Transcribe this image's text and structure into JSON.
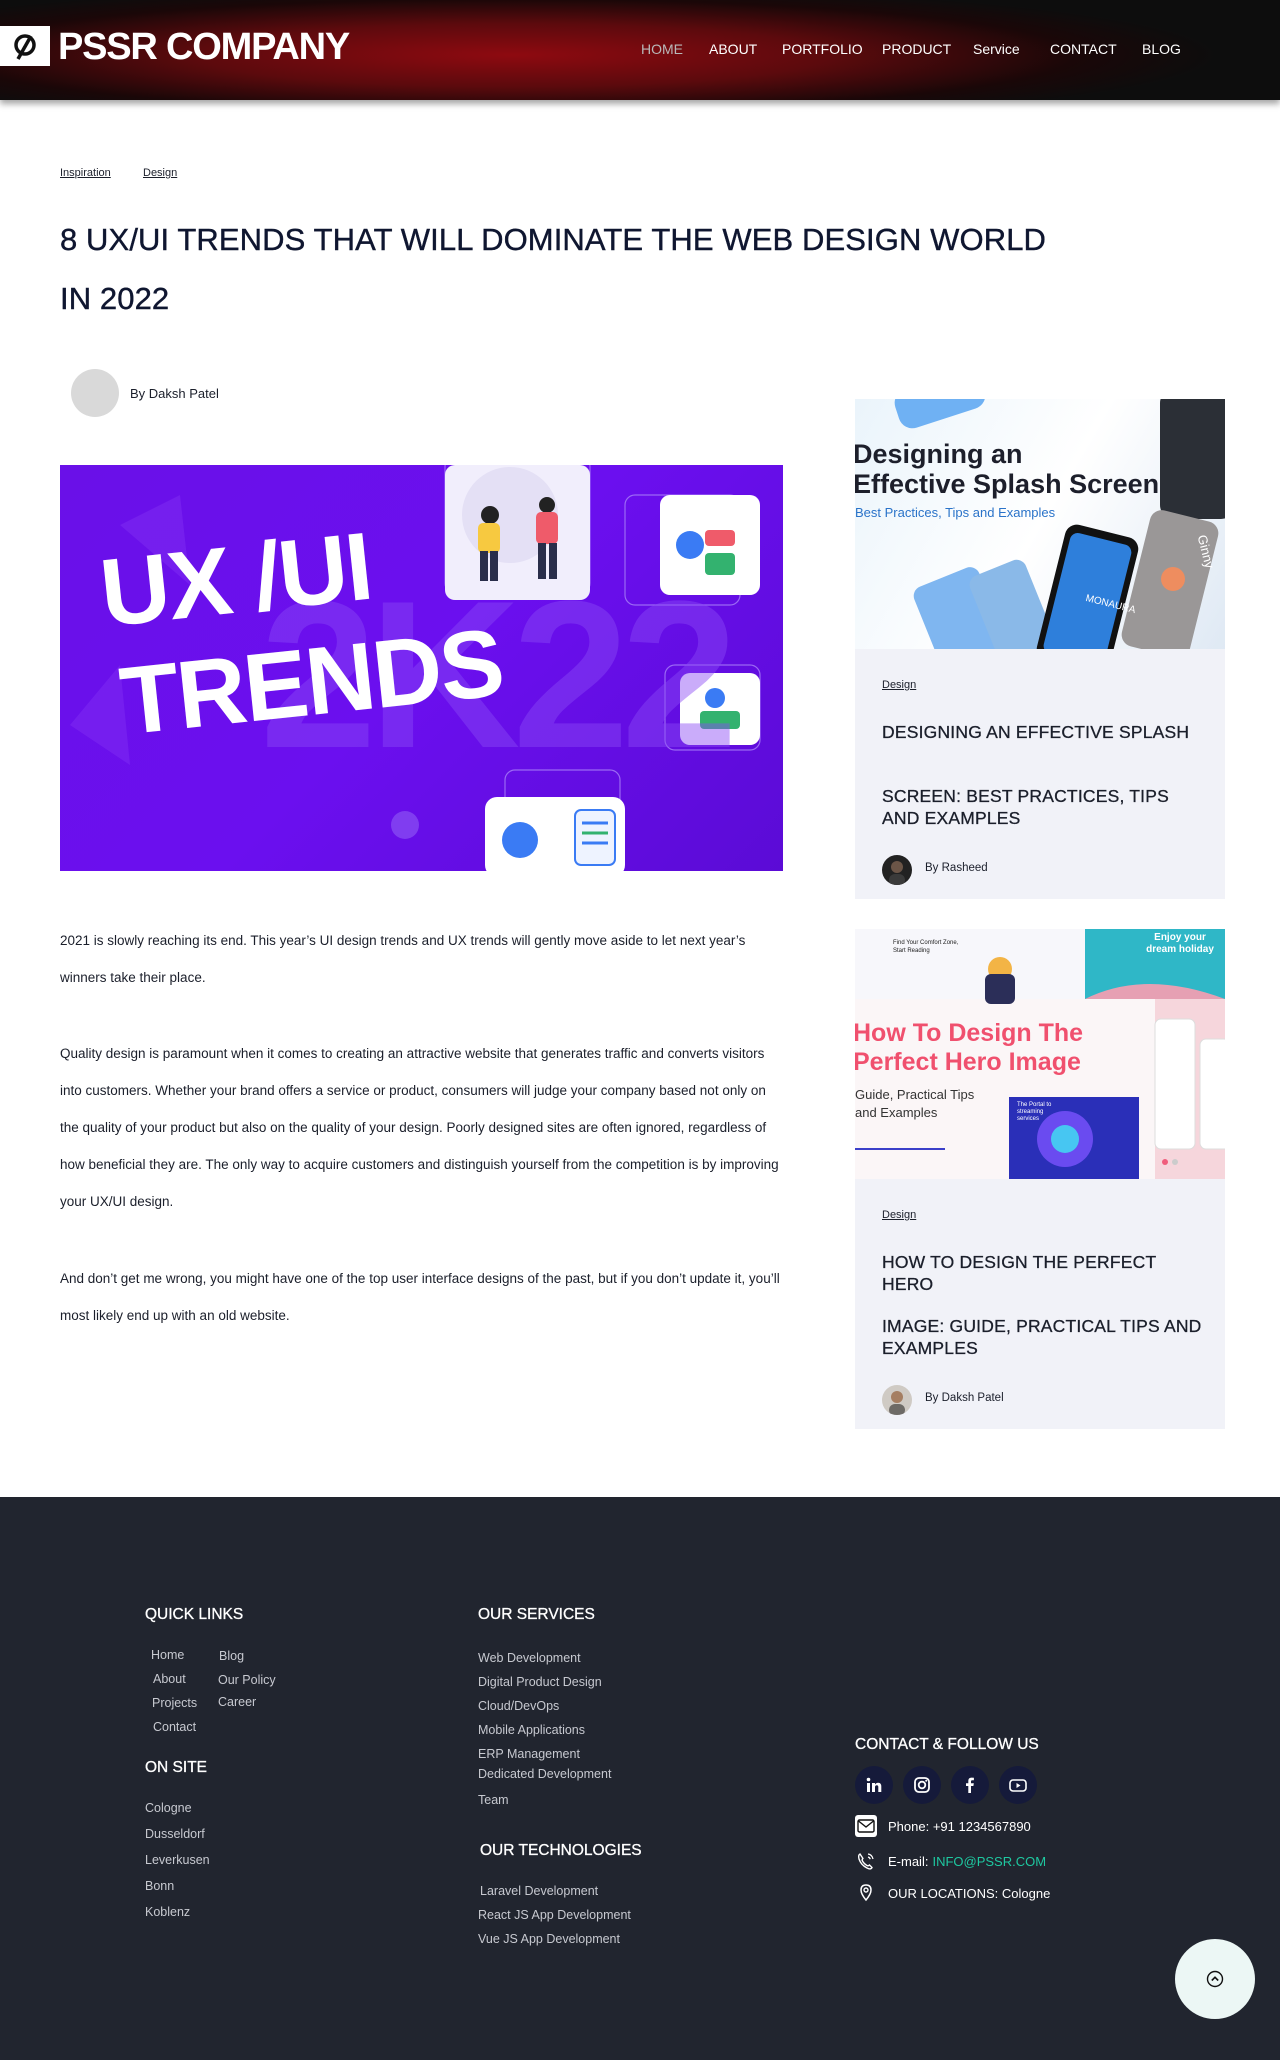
{
  "header": {
    "brand": "PSSR COMPANY",
    "nav": [
      {
        "label": "HOME",
        "active": true
      },
      {
        "label": "ABOUT"
      },
      {
        "label": "PORTFOLIO"
      },
      {
        "label": "PRODUCT"
      },
      {
        "label": "Service"
      },
      {
        "label": "CONTACT"
      },
      {
        "label": "BLOG"
      }
    ]
  },
  "article": {
    "tags": [
      "Inspiration",
      "Design"
    ],
    "title_line1": "8 UX/UI TRENDS THAT WILL DOMINATE THE WEB DESIGN WORLD",
    "title_line2": "IN 2022",
    "author": "By Daksh Patel",
    "hero_text_line1": "UX /UI",
    "hero_text_line2": "TRENDS",
    "hero_bg_text": "2K22",
    "paragraphs": [
      "2021 is slowly reaching its end. This year’s UI design trends and UX trends will gently move aside to let next year’s winners take their place.",
      "Quality design is paramount when it comes to creating an attractive website that generates traffic and converts visitors into customers. Whether your brand offers a service or product, consumers will judge your company based not only on the quality of your product but also on the quality of your design. Poorly designed sites are often ignored, regardless of how beneficial they are. The only way to acquire customers and distinguish yourself from the competition is by improving your UX/UI design.",
      "And don’t get me wrong, you might have one of the top user interface designs of the past, but if you don’t update it, you’ll most likely end up with an old website."
    ]
  },
  "sidebar": {
    "cards": [
      {
        "image_title_line1": "Designing an",
        "image_title_line2": "Effective Splash Screen",
        "image_subtitle": "Best Practices, Tips and Examples",
        "image_app_name": "MONAURA",
        "image_app_name2": "Ginny",
        "tag": "Design",
        "title_line1": "DESIGNING AN EFFECTIVE SPLASH",
        "title_line2": "SCREEN: BEST PRACTICES, TIPS AND EXAMPLES",
        "author": "By Rasheed"
      },
      {
        "image_title_line1": "How To Design The",
        "image_title_line2": "Perfect Hero Image",
        "image_subtitle_line1": "Guide, Practical Tips",
        "image_subtitle_line2": "and Examples",
        "image_banner": "Enjoy your dream holiday",
        "image_snippet": "Find Your Comfort Zone, Start Reading",
        "image_tile": "The Portal to streaming services",
        "tag": "Design",
        "title_line1": "HOW TO DESIGN THE PERFECT HERO",
        "title_line2": "IMAGE: GUIDE, PRACTICAL TIPS AND EXAMPLES",
        "author": "By Daksh Patel"
      }
    ]
  },
  "footer": {
    "quick_links_title": "QUICK LINKS",
    "quick_links_col1": [
      "Home",
      "About",
      "Projects",
      "Contact"
    ],
    "quick_links_col2": [
      "Blog",
      "Our Policy",
      "Career"
    ],
    "on_site_title": "ON SITE",
    "on_site": [
      "Cologne",
      "Dusseldorf",
      "Leverkusen",
      "Bonn",
      "Koblenz"
    ],
    "services_title": "OUR SERVICES",
    "services": [
      "Web Development",
      "Digital Product Design",
      "Cloud/DevOps",
      "Mobile Applications",
      "ERP Management",
      "Dedicated Development",
      "Team"
    ],
    "technologies_title": "OUR TECHNOLOGIES",
    "technologies": [
      "Laravel Development",
      "React JS App Development",
      "Vue JS App Development"
    ],
    "contact_title": "CONTACT & FOLLOW US",
    "social": [
      "linkedin-icon",
      "instagram-icon",
      "facebook-icon",
      "youtube-icon"
    ],
    "phone": "Phone: +91 1234567890",
    "email_label": "E-mail:",
    "email_value": "INFO@PSSR.COM",
    "locations": "OUR LOCATIONS: Cologne"
  },
  "colors": {
    "header_red": "#8e0a10",
    "footer_bg": "#21252f",
    "card_bg": "#f1f2f8",
    "hero_purple": "#6a10e8",
    "email_green": "#1ec8a0"
  }
}
